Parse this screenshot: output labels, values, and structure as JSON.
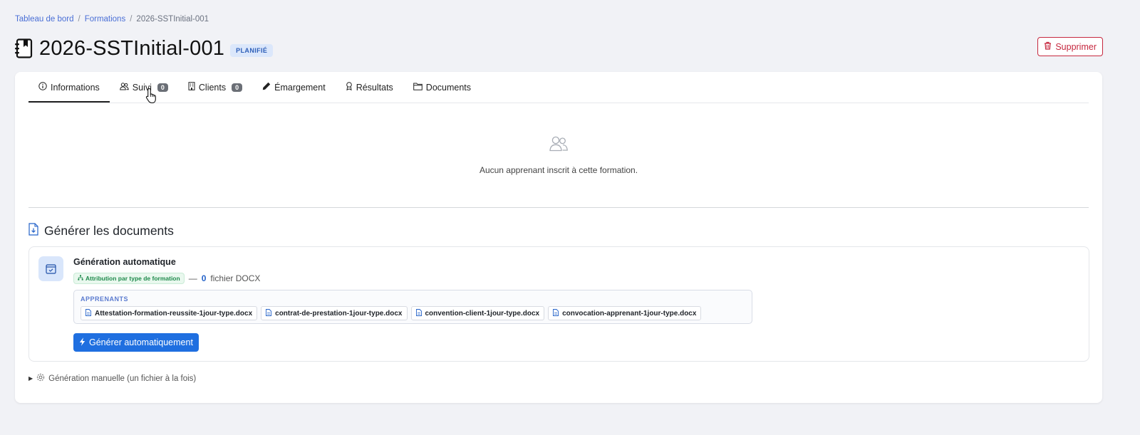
{
  "breadcrumb": {
    "items": [
      "Tableau de bord",
      "Formations",
      "2026-SSTInitial-001"
    ],
    "separator": "/"
  },
  "header": {
    "title": "2026-SSTInitial-001",
    "status": "PLANIFIÉ",
    "delete_label": "Supprimer"
  },
  "tabs": [
    {
      "label": "Informations",
      "icon": "info-icon",
      "active": true
    },
    {
      "label": "Suivi",
      "icon": "users-icon",
      "count": "0"
    },
    {
      "label": "Clients",
      "icon": "building-icon",
      "count": "0"
    },
    {
      "label": "Émargement",
      "icon": "pen-icon"
    },
    {
      "label": "Résultats",
      "icon": "award-icon"
    },
    {
      "label": "Documents",
      "icon": "folder-icon"
    }
  ],
  "empty_state": {
    "message": "Aucun apprenant inscrit à cette formation."
  },
  "documents": {
    "section_title": "Générer les documents",
    "auto": {
      "title": "Génération automatique",
      "attribution_badge": "Attribution par type de formation",
      "dash": "—",
      "file_count": "0",
      "file_count_suffix": "fichier DOCX",
      "group_label": "APPRENANTS",
      "files": [
        "Attestation-formation-reussite-1jour-type.docx",
        "contrat-de-prestation-1jour-type.docx",
        "convention-client-1jour-type.docx",
        "convocation-apprenant-1jour-type.docx"
      ],
      "button_label": "Générer automatiquement"
    },
    "manual_label": "Génération manuelle (un fichier à la fois)"
  },
  "colors": {
    "accent": "#1f6fe0",
    "danger": "#c6283f",
    "badge_bg": "#dbe7fb",
    "success": "#1f8a4c"
  }
}
